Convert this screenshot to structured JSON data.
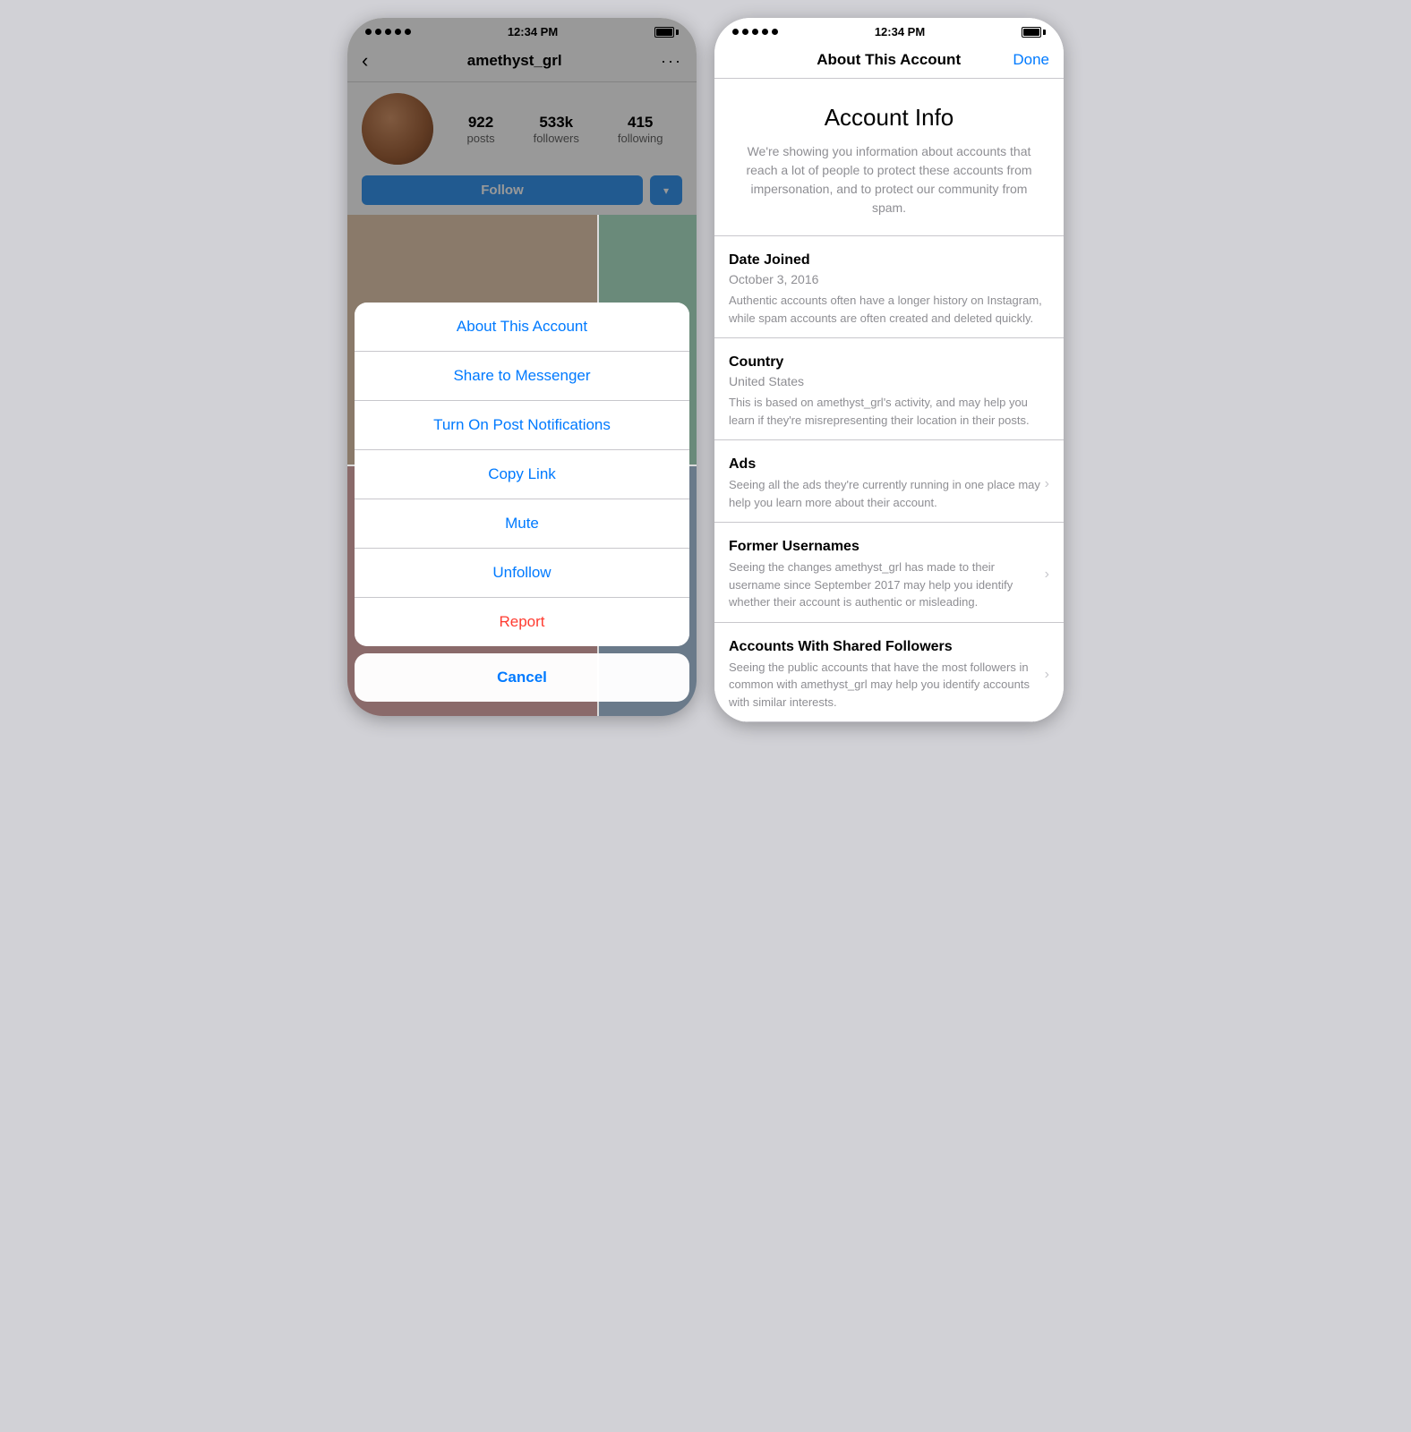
{
  "left_phone": {
    "status_bar": {
      "time": "12:34 PM"
    },
    "nav": {
      "username": "amethyst_grl",
      "back_label": "‹",
      "more_label": "···"
    },
    "profile": {
      "posts_count": "922",
      "posts_label": "posts",
      "followers_count": "533k",
      "followers_label": "followers",
      "following_count": "415",
      "following_label": "following",
      "follow_label": "Follow",
      "username_label": "amethyst_grl"
    },
    "action_sheet": {
      "items": [
        {
          "label": "About This Account",
          "color": "blue"
        },
        {
          "label": "Share to Messenger",
          "color": "blue"
        },
        {
          "label": "Turn On Post Notifications",
          "color": "blue"
        },
        {
          "label": "Copy Link",
          "color": "blue"
        },
        {
          "label": "Mute",
          "color": "blue"
        },
        {
          "label": "Unfollow",
          "color": "blue"
        },
        {
          "label": "Report",
          "color": "red"
        }
      ],
      "cancel_label": "Cancel"
    }
  },
  "right_phone": {
    "status_bar": {
      "time": "12:34 PM"
    },
    "nav": {
      "title": "About This Account",
      "done_label": "Done"
    },
    "account_info": {
      "title": "Account Info",
      "description": "We're showing you information about accounts that reach a lot of people to protect these accounts from impersonation, and to protect our community from spam."
    },
    "sections": [
      {
        "title": "Date Joined",
        "value": "October 3, 2016",
        "description": "Authentic accounts often have a longer history on Instagram, while spam accounts are often created and deleted quickly.",
        "has_chevron": false
      },
      {
        "title": "Country",
        "value": "United States",
        "description": "This is based on amethyst_grl's activity, and may help you learn if they're misrepresenting their location in their posts.",
        "has_chevron": false
      },
      {
        "title": "Ads",
        "value": "",
        "description": "Seeing all the ads they're currently running in one place may help you learn more about their account.",
        "has_chevron": true
      },
      {
        "title": "Former Usernames",
        "value": "",
        "description": "Seeing the changes amethyst_grl has made to their username since September 2017 may help you identify whether their account is authentic or misleading.",
        "has_chevron": true
      },
      {
        "title": "Accounts With Shared Followers",
        "value": "",
        "description": "Seeing the public accounts that have the most followers in common with amethyst_grl may help you identify accounts with similar interests.",
        "has_chevron": true
      }
    ]
  }
}
